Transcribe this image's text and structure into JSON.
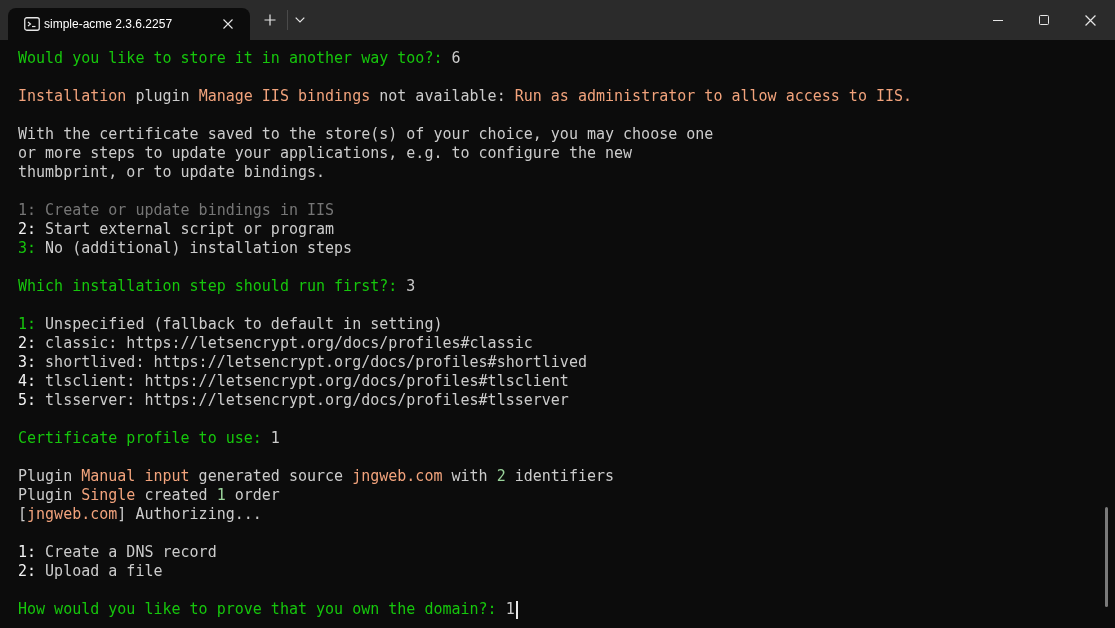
{
  "window": {
    "tabs": [
      {
        "title": "simple-acme 2.3.6.2257",
        "selected": true
      }
    ]
  },
  "terminal": {
    "blocks": [
      {
        "lines": [
          {
            "kind": "prompt",
            "question": "Would you like to store it in another way too?:",
            "answer": "6",
            "cursor": false
          }
        ]
      },
      {
        "lines": [
          {
            "kind": "message",
            "segments": [
              {
                "kind": "highlight",
                "text": "Installation"
              },
              {
                "kind": "plain",
                "text": " plugin "
              },
              {
                "kind": "highlight",
                "text": "Manage IIS bindings"
              },
              {
                "kind": "plain",
                "text": " not available: "
              },
              {
                "kind": "highlight",
                "text": "Run as administrator to allow access to IIS."
              }
            ]
          }
        ]
      },
      {
        "lines": [
          {
            "kind": "message",
            "segments": [
              {
                "kind": "plain",
                "text": "With the certificate saved to the store(s) of your choice, you may choose one"
              }
            ]
          },
          {
            "kind": "message",
            "segments": [
              {
                "kind": "plain",
                "text": "or more steps to update your applications, e.g. to configure the new"
              }
            ]
          },
          {
            "kind": "message",
            "segments": [
              {
                "kind": "plain",
                "text": "thumbprint, or to update bindings."
              }
            ]
          }
        ]
      },
      {
        "lines": [
          {
            "kind": "option",
            "number": "1:",
            "text": "Create or update bindings in IIS",
            "default": false,
            "disabled": true
          },
          {
            "kind": "option",
            "number": "2:",
            "text": "Start external script or program",
            "default": false,
            "disabled": false
          },
          {
            "kind": "option",
            "number": "3:",
            "text": "No (additional) installation steps",
            "default": true,
            "disabled": false
          }
        ]
      },
      {
        "lines": [
          {
            "kind": "prompt",
            "question": "Which installation step should run first?:",
            "answer": "3",
            "cursor": false
          }
        ]
      },
      {
        "lines": [
          {
            "kind": "option",
            "number": "1:",
            "text": "Unspecified (fallback to default in setting)",
            "default": true,
            "disabled": false
          },
          {
            "kind": "option",
            "number": "2:",
            "text": "classic: https://letsencrypt.org/docs/profiles#classic",
            "default": false,
            "disabled": false
          },
          {
            "kind": "option",
            "number": "3:",
            "text": "shortlived: https://letsencrypt.org/docs/profiles#shortlived",
            "default": false,
            "disabled": false
          },
          {
            "kind": "option",
            "number": "4:",
            "text": "tlsclient: https://letsencrypt.org/docs/profiles#tlsclient",
            "default": false,
            "disabled": false
          },
          {
            "kind": "option",
            "number": "5:",
            "text": "tlsserver: https://letsencrypt.org/docs/profiles#tlsserver",
            "default": false,
            "disabled": false
          }
        ]
      },
      {
        "lines": [
          {
            "kind": "prompt",
            "question": "Certificate profile to use:",
            "answer": "1",
            "cursor": false
          }
        ]
      },
      {
        "lines": [
          {
            "kind": "message",
            "segments": [
              {
                "kind": "plain",
                "text": "Plugin "
              },
              {
                "kind": "highlight",
                "text": "Manual input"
              },
              {
                "kind": "plain",
                "text": " generated source "
              },
              {
                "kind": "highlight",
                "text": "jngweb.com"
              },
              {
                "kind": "plain",
                "text": " with "
              },
              {
                "kind": "count",
                "text": "2"
              },
              {
                "kind": "plain",
                "text": " identifiers"
              }
            ]
          },
          {
            "kind": "message",
            "segments": [
              {
                "kind": "plain",
                "text": "Plugin "
              },
              {
                "kind": "highlight",
                "text": "Single"
              },
              {
                "kind": "plain",
                "text": " created "
              },
              {
                "kind": "count",
                "text": "1"
              },
              {
                "kind": "plain",
                "text": " order"
              }
            ]
          },
          {
            "kind": "message",
            "segments": [
              {
                "kind": "plain",
                "text": "["
              },
              {
                "kind": "highlight",
                "text": "jngweb.com"
              },
              {
                "kind": "plain",
                "text": "] Authorizing..."
              }
            ]
          }
        ]
      },
      {
        "lines": [
          {
            "kind": "option",
            "number": "1:",
            "text": "Create a DNS record",
            "default": false,
            "disabled": false
          },
          {
            "kind": "option",
            "number": "2:",
            "text": "Upload a file",
            "default": false,
            "disabled": false
          }
        ]
      },
      {
        "lines": [
          {
            "kind": "prompt",
            "question": "How would you like to prove that you own the domain?:",
            "answer": "1",
            "cursor": true
          }
        ]
      }
    ]
  }
}
